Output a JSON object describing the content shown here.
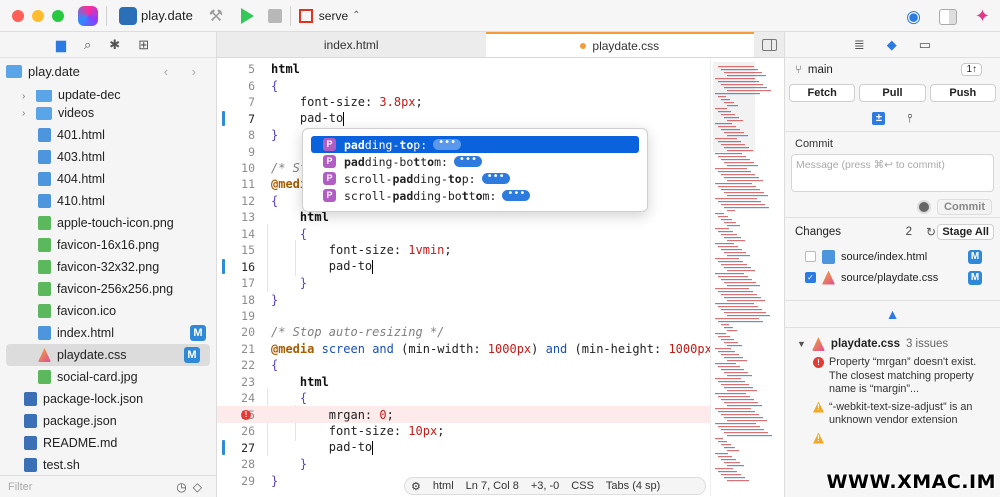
{
  "toolbar": {
    "project_name": "play.date",
    "scheme_label": "serve",
    "updown": "⌃",
    "hammer": "⚒",
    "eye": "◉",
    "sparkle": "✦"
  },
  "navigator": {
    "root_label": "play.date",
    "arrows": "‹ ›",
    "items": [
      {
        "label": "update-dec",
        "type": "folder",
        "indent": 1
      },
      {
        "label": "videos",
        "type": "folder",
        "indent": 1
      },
      {
        "label": "401.html",
        "type": "html",
        "indent": 2
      },
      {
        "label": "403.html",
        "type": "html",
        "indent": 2
      },
      {
        "label": "404.html",
        "type": "html",
        "indent": 2
      },
      {
        "label": "410.html",
        "type": "html",
        "indent": 2
      },
      {
        "label": "apple-touch-icon.png",
        "type": "png",
        "indent": 2
      },
      {
        "label": "favicon-16x16.png",
        "type": "png",
        "indent": 2
      },
      {
        "label": "favicon-32x32.png",
        "type": "png",
        "indent": 2
      },
      {
        "label": "favicon-256x256.png",
        "type": "png",
        "indent": 2
      },
      {
        "label": "favicon.ico",
        "type": "png",
        "indent": 2
      },
      {
        "label": "index.html",
        "type": "html",
        "indent": 2,
        "badge": "M"
      },
      {
        "label": "playdate.css",
        "type": "css",
        "indent": 2,
        "badge": "M",
        "selected": true
      },
      {
        "label": "social-card.jpg",
        "type": "png",
        "indent": 2
      },
      {
        "label": "package-lock.json",
        "type": "json",
        "indent": 0
      },
      {
        "label": "package.json",
        "type": "json",
        "indent": 0
      },
      {
        "label": "README.md",
        "type": "md",
        "indent": 0
      },
      {
        "label": "test.sh",
        "type": "sh",
        "indent": 0
      }
    ],
    "filter_placeholder": "Filter"
  },
  "tabs": [
    {
      "label": "index.html",
      "active": false
    },
    {
      "label": "playdate.css",
      "active": true,
      "modified": true
    }
  ],
  "editor": {
    "lines": [
      {
        "n": "5",
        "html": "<span class='k-sel'>html</span>"
      },
      {
        "n": "6",
        "html": "<span class='k-brace'>{</span>"
      },
      {
        "n": "7",
        "html": "    <span class='k-prop'>font-size</span>: <span class='k-num'>3.8px</span>;"
      },
      {
        "n": "7",
        "html": "    pad-to<span class='cursor'></span>",
        "current": true,
        "bar": true
      },
      {
        "n": "8",
        "html": "<span class='k-brace'>}</span>"
      },
      {
        "n": "9",
        "html": ""
      },
      {
        "n": "10",
        "html": "<span class='k-com'>/* St</span>"
      },
      {
        "n": "11",
        "html": "<span class='k-at'>@medi</span>                                          <span class='k-num'>px</span>)"
      },
      {
        "n": "12",
        "html": "<span class='k-brace'>{</span>"
      },
      {
        "n": "13",
        "html": "    <span class='k-sel'>html</span>"
      },
      {
        "n": "14",
        "html": "    <span class='k-brace'>{</span>"
      },
      {
        "n": "15",
        "html": "        <span class='k-prop'>font-size</span>: <span class='k-num'>1vmin</span>;"
      },
      {
        "n": "16",
        "html": "        pad-to<span class='cursor'></span>",
        "current": true,
        "bar": true
      },
      {
        "n": "17",
        "html": "    <span class='k-brace'>}</span>"
      },
      {
        "n": "18",
        "html": "<span class='k-brace'>}</span>"
      },
      {
        "n": "19",
        "html": ""
      },
      {
        "n": "20",
        "html": "<span class='k-com'>/* Stop auto-resizing */</span>"
      },
      {
        "n": "21",
        "html": "<span class='k-at'>@media</span> <span class='k-kw'>screen</span> <span class='k-kw'>and</span> (min-width: <span class='k-num'>1000px</span>) <span class='k-kw'>and</span> (min-height: <span class='k-num'>1000px</span>)"
      },
      {
        "n": "22",
        "html": "<span class='k-brace'>{</span>"
      },
      {
        "n": "23",
        "html": "    <span class='k-sel'>html</span>"
      },
      {
        "n": "24",
        "html": "    <span class='k-brace'>{</span>"
      },
      {
        "n": "25",
        "html": "        <span class='k-prop'>mrgan</span>: <span class='k-num'>0</span>;",
        "error": true
      },
      {
        "n": "26",
        "html": "        <span class='k-prop'>font-size</span>: <span class='k-num'>10px</span>;"
      },
      {
        "n": "27",
        "html": "        pad-to<span class='cursor'></span>",
        "current": true,
        "bar": true
      },
      {
        "n": "28",
        "html": "    <span class='k-brace'>}</span>"
      },
      {
        "n": "29",
        "html": "<span class='k-brace'>}</span>"
      }
    ]
  },
  "autocomplete": {
    "items": [
      {
        "html": "<b>pad</b>ding-<b>to</b>p:",
        "selected": true
      },
      {
        "html": "<b>pad</b>ding-bo<b>t</b>t<b>o</b>m:"
      },
      {
        "html": "scroll-<b>pad</b>ding-<b>to</b>p:"
      },
      {
        "html": "scroll-<b>pad</b>ding-bo<b>t</b>t<b>o</b>m:"
      }
    ],
    "badge_letter": "P",
    "dots": "•••"
  },
  "status": {
    "lang": "html",
    "position": "Ln 7, Col 8",
    "delta": "+3, -0",
    "syntax": "CSS",
    "indent": "Tabs (4 sp)"
  },
  "inspector": {
    "branch": "main",
    "branch_pill": "1↑",
    "buttons": [
      "Fetch",
      "Pull",
      "Push"
    ],
    "commit_label": "Commit",
    "commit_placeholder": "Message (press ⌘↩ to commit)",
    "commit_button": "Commit",
    "changes_label": "Changes",
    "changes_count": "2",
    "stage_all": "Stage All",
    "changes": [
      {
        "path": "source/index.html",
        "checked": false,
        "type": "html",
        "badge": "M"
      },
      {
        "path": "source/playdate.css",
        "checked": true,
        "type": "css",
        "badge": "M"
      }
    ],
    "issue_file": "playdate.css",
    "issue_count": "3 issues",
    "issues": [
      {
        "kind": "error",
        "text": "Property “mrgan” doesn't exist. The closest matching property name is “margin”..."
      },
      {
        "kind": "warn",
        "text": "“-webkit-text-size-adjust” is an unknown vendor extension"
      },
      {
        "kind": "warn",
        "text": ""
      }
    ]
  },
  "watermark": "WWW.XMAC.IM"
}
